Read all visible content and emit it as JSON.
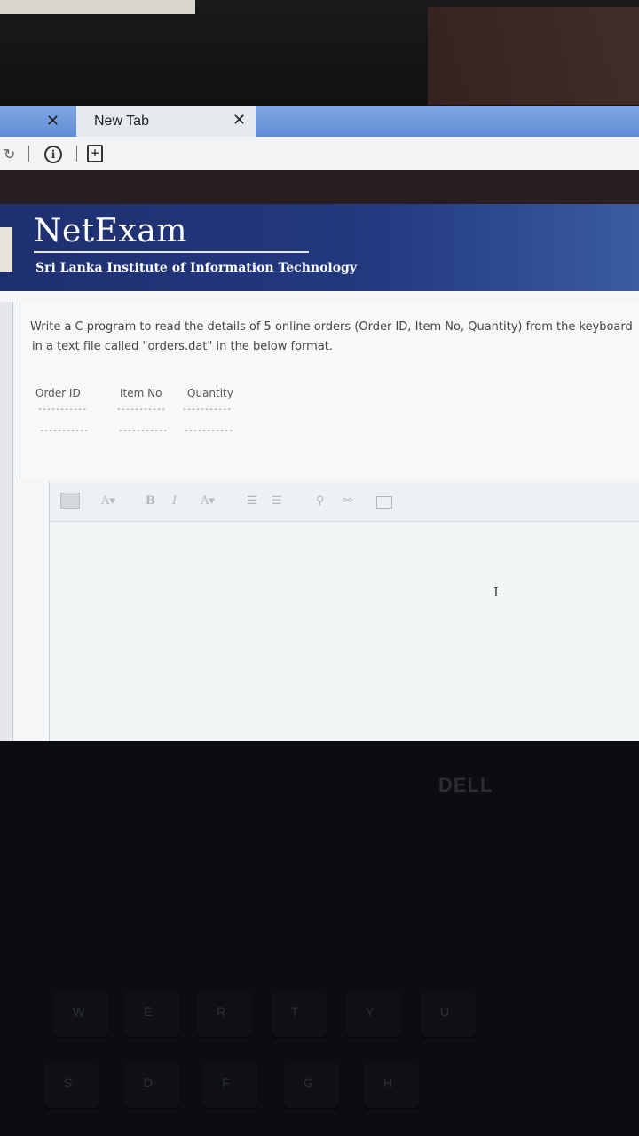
{
  "browser": {
    "tab_title": "New Tab",
    "close_glyph": "✕"
  },
  "header": {
    "title": "NetExam",
    "subtitle": "Sri Lanka Institute of Information Technology"
  },
  "question": {
    "line1": "Write a C program to read the details of  5 online orders (Order ID, Item No, Quantity)  from the keyboard",
    "line2": "in a text file called   \"orders.dat\" in the below format."
  },
  "format_table": {
    "columns": [
      "Order ID",
      "Item No",
      "Quantity"
    ],
    "dash": "-----------"
  },
  "editor": {
    "toolbar_buttons": [
      "A▾",
      "B",
      "I",
      "A▾"
    ],
    "cursor_glyph": "I"
  },
  "laptop": {
    "brand": "DELL",
    "keys_row1": [
      "W",
      "E",
      "R",
      "T",
      "Y",
      "U"
    ],
    "keys_row2": [
      "S",
      "D",
      "F",
      "G",
      "H"
    ]
  }
}
